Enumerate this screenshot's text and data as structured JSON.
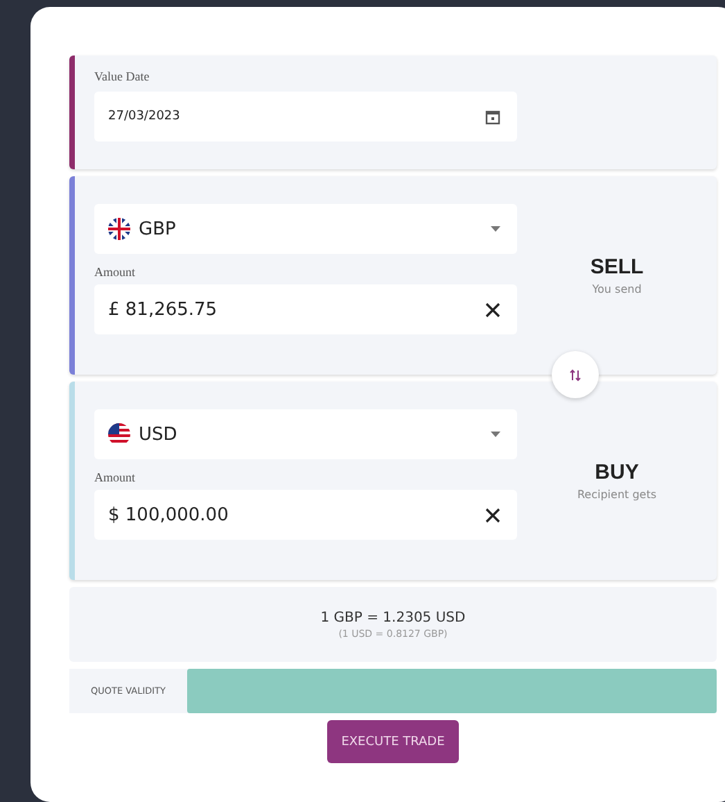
{
  "value_date": {
    "label": "Value Date",
    "value": "27/03/2023"
  },
  "legs": [
    {
      "currency": "GBP",
      "kind": "gb",
      "amount_label": "Amount",
      "amount": "£ 81,265.75",
      "side": "SELL",
      "side_note": "You send",
      "color": "#7b80d8"
    },
    {
      "currency": "USD",
      "kind": "us",
      "amount_label": "Amount",
      "amount": "$ 100,000.00",
      "side": "BUY",
      "side_note": "Recipient gets",
      "color": "#b9dde9"
    }
  ],
  "rate": {
    "main": "1 GBP = 1.2305 USD",
    "inverse": "(1 USD = 0.8127 GBP)"
  },
  "quote_validity": {
    "label": "QUOTE VALIDITY"
  },
  "execute_button": "EXECUTE TRADE"
}
